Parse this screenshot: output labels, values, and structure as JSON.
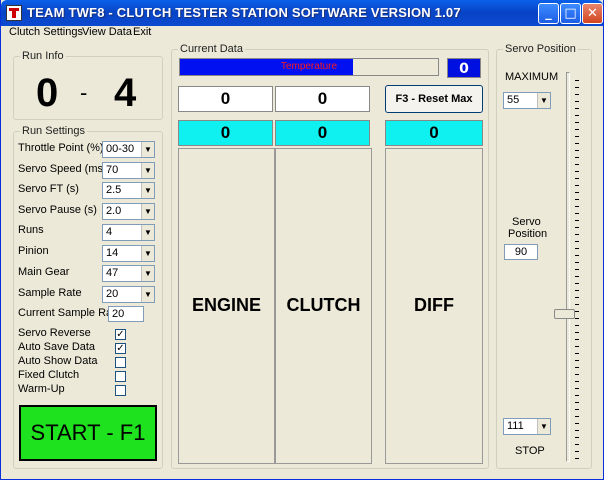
{
  "window": {
    "title": "TEAM TWF8 - CLUTCH TESTER STATION SOFTWARE VERSION 1.07",
    "controls": {
      "minimize": "_",
      "maximize": "□",
      "close": "✕"
    }
  },
  "menu": [
    "Clutch Settings",
    "View Data",
    "Exit"
  ],
  "run_info": {
    "label": "Run Info",
    "current": "0",
    "separator": "-",
    "total": "4"
  },
  "run_settings": {
    "label": "Run Settings",
    "rows": [
      {
        "label": "Throttle Point (%)",
        "value": "00-30"
      },
      {
        "label": "Servo Speed (ms)",
        "value": "70"
      },
      {
        "label": "Servo FT (s)",
        "value": "2.5"
      },
      {
        "label": "Servo Pause (s)",
        "value": "2.0"
      },
      {
        "label": "Runs",
        "value": "4"
      },
      {
        "label": "Pinion",
        "value": "14"
      },
      {
        "label": "Main Gear",
        "value": "47"
      },
      {
        "label": "Sample Rate",
        "value": "20"
      }
    ],
    "current_sample_rate": {
      "label": "Current Sample Rate",
      "value": "20"
    },
    "checkboxes": [
      {
        "label": "Servo Reverse",
        "checked": true,
        "mark": "✓"
      },
      {
        "label": "Auto Save Data",
        "checked": true,
        "mark": "✓"
      },
      {
        "label": "Auto Show Data",
        "checked": false,
        "mark": ""
      },
      {
        "label": "Fixed Clutch",
        "checked": false,
        "mark": ""
      },
      {
        "label": "Warm-Up",
        "checked": false,
        "mark": ""
      }
    ]
  },
  "start_button": {
    "label": "START - F1",
    "color": "#1de21d"
  },
  "current_data": {
    "label": "Current Data",
    "temperature": {
      "label": "Temperature",
      "value": "0",
      "fill_fraction": 0.67
    },
    "reset_button": "F3 - Reset Max",
    "engine": {
      "label": "ENGINE",
      "max": "0",
      "current": "0"
    },
    "clutch": {
      "label": "CLUTCH",
      "max": "0",
      "current": "0"
    },
    "diff": {
      "label": "DIFF",
      "current": "0"
    },
    "arrow_glyph": "▼"
  },
  "servo_position": {
    "label": "Servo Position",
    "maximum_label": "MAXIMUM",
    "maximum_value": "55",
    "position_label_1": "Servo",
    "position_label_2": "Position",
    "position_value": "90",
    "stop_value": "111",
    "stop_label": "STOP"
  },
  "colors": {
    "accent_cyan": "#0ff0f0",
    "temp_blue": "#0010f0",
    "temp_text_red": "#ff1a1a",
    "start_green": "#1de21d"
  }
}
